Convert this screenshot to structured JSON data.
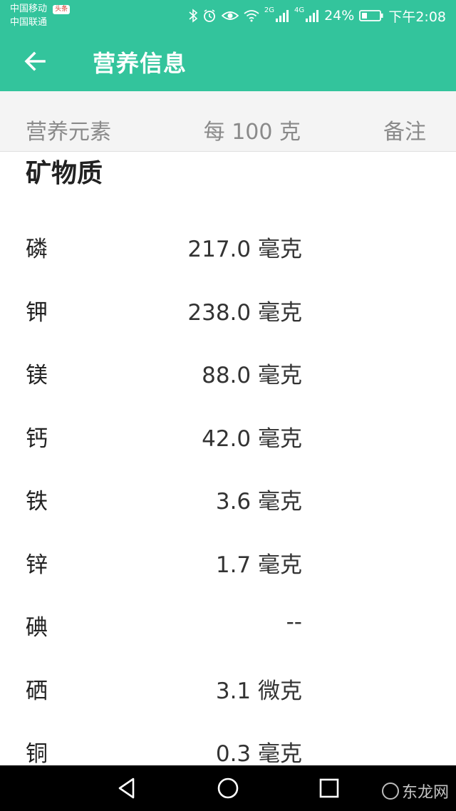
{
  "status_bar": {
    "carrier_1": "中国移动",
    "carrier_2": "中国联通",
    "news_badge": "头条",
    "network_1": "2G",
    "network_2": "4G",
    "battery": "24%",
    "time": "下午2:08",
    "icons": [
      "bluetooth-icon",
      "alarm-icon",
      "eye-icon",
      "wifi-icon",
      "signal-icon",
      "battery-icon"
    ]
  },
  "app_bar": {
    "back_icon": "arrow-left-icon",
    "title": "营养信息"
  },
  "columns": {
    "name": "营养元素",
    "amount": "每 100 克",
    "note": "备注"
  },
  "section": {
    "title": "矿物质",
    "items": [
      {
        "name": "磷",
        "amount": "217.0 毫克"
      },
      {
        "name": "钾",
        "amount": "238.0 毫克"
      },
      {
        "name": "镁",
        "amount": "88.0 毫克"
      },
      {
        "name": "钙",
        "amount": "42.0 毫克"
      },
      {
        "name": "铁",
        "amount": "3.6 毫克"
      },
      {
        "name": "锌",
        "amount": "1.7 毫克"
      },
      {
        "name": "碘",
        "amount": "--"
      },
      {
        "name": "硒",
        "amount": "3.1 微克"
      },
      {
        "name": "铜",
        "amount": "0.3 毫克"
      }
    ]
  },
  "nav_bar": {
    "icons": [
      "back-triangle-icon",
      "home-circle-icon",
      "recents-square-icon"
    ],
    "watermark": "东龙网"
  },
  "colors": {
    "primary": "#33c49c",
    "header_bg": "#f4f4f4",
    "nav_bg": "#000000"
  }
}
